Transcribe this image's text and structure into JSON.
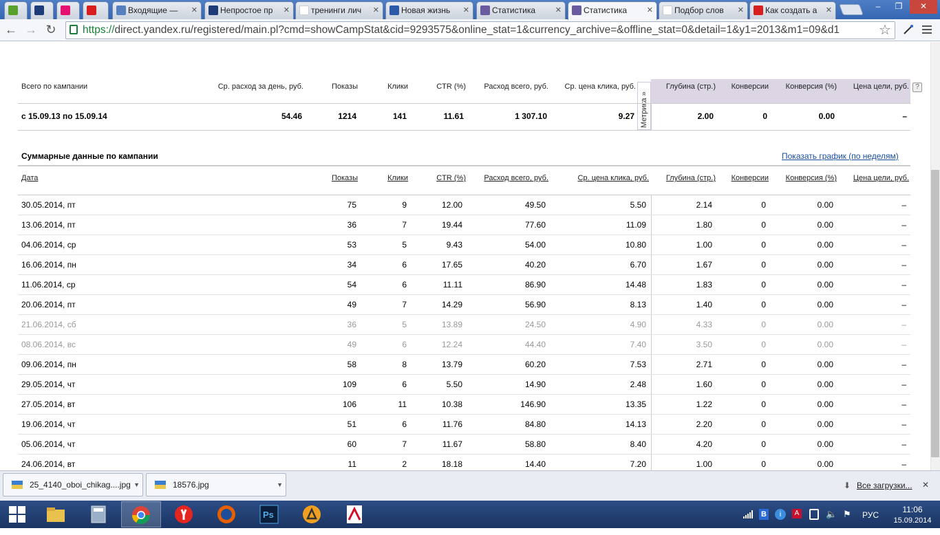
{
  "tabs": [
    {
      "label": "",
      "favicon": "green-f-icon"
    },
    {
      "label": "",
      "favicon": "bm-icon"
    },
    {
      "label": "",
      "favicon": "pink-icon"
    },
    {
      "label": "",
      "favicon": "red-2-icon"
    },
    {
      "label": "Входящие — ",
      "favicon": "mail-icon"
    },
    {
      "label": "Непростое пр",
      "favicon": "bm-icon"
    },
    {
      "label": "тренинги лич",
      "favicon": "yandex-icon"
    },
    {
      "label": "Новая жизнь",
      "favicon": "doc-icon"
    },
    {
      "label": "Статистика",
      "favicon": "direct-icon"
    },
    {
      "label": "Статистика",
      "favicon": "direct-icon",
      "active": true
    },
    {
      "label": "Подбор слов",
      "favicon": "chart-icon"
    },
    {
      "label": "Как создать а",
      "favicon": "youtube-icon"
    }
  ],
  "window": {
    "minimize": "–",
    "restore": "❐",
    "close": "✕"
  },
  "toolbar": {
    "back": "←",
    "forward": "→",
    "reload": "↻",
    "url_scheme": "https://",
    "url_rest": "direct.yandex.ru/registered/main.pl?cmd=showCampStat&cid=9293575&online_stat=1&currency_archive=&offline_stat=0&detail=1&y1=2013&m1=09&d1",
    "star": "☆"
  },
  "summary": {
    "headers": [
      "Всего по кампании",
      "Ср. расход за день, руб.",
      "Показы",
      "Клики",
      "CTR (%)",
      "Расход всего, руб.",
      "Ср. цена клика, руб.",
      "Глубина (стр.)",
      "Конверсии",
      "Конверсия (%)",
      "Цена цели, руб."
    ],
    "values": [
      "с 15.09.13 по 15.09.14",
      "54.46",
      "1214",
      "141",
      "11.61",
      "1 307.10",
      "9.27",
      "2.00",
      "0",
      "0.00",
      "–"
    ],
    "help": "?",
    "metrika": "Метрика »"
  },
  "section": {
    "title": "Суммарные данные по кампании",
    "graph_link": "Показать график (по неделям)"
  },
  "detail_headers": [
    "Дата",
    "Показы",
    "Клики",
    "CTR (%)",
    "Расход всего, руб.",
    "Ср. цена клика, руб.",
    "Глубина (стр.)",
    "Конверсии",
    "Конверсия (%)",
    "Цена цели, руб."
  ],
  "rows": [
    {
      "cells": [
        "30.05.2014, пт",
        "75",
        "9",
        "12.00",
        "49.50",
        "5.50",
        "2.14",
        "0",
        "0.00",
        "–"
      ]
    },
    {
      "cells": [
        "13.06.2014, пт",
        "36",
        "7",
        "19.44",
        "77.60",
        "11.09",
        "1.80",
        "0",
        "0.00",
        "–"
      ]
    },
    {
      "cells": [
        "04.06.2014, ср",
        "53",
        "5",
        "9.43",
        "54.00",
        "10.80",
        "1.00",
        "0",
        "0.00",
        "–"
      ]
    },
    {
      "cells": [
        "16.06.2014, пн",
        "34",
        "6",
        "17.65",
        "40.20",
        "6.70",
        "1.67",
        "0",
        "0.00",
        "–"
      ]
    },
    {
      "cells": [
        "11.06.2014, ср",
        "54",
        "6",
        "11.11",
        "86.90",
        "14.48",
        "1.83",
        "0",
        "0.00",
        "–"
      ]
    },
    {
      "cells": [
        "20.06.2014, пт",
        "49",
        "7",
        "14.29",
        "56.90",
        "8.13",
        "1.40",
        "0",
        "0.00",
        "–"
      ]
    },
    {
      "cells": [
        "21.06.2014, сб",
        "36",
        "5",
        "13.89",
        "24.50",
        "4.90",
        "4.33",
        "0",
        "0.00",
        "–"
      ],
      "weekend": true
    },
    {
      "cells": [
        "08.06.2014, вс",
        "49",
        "6",
        "12.24",
        "44.40",
        "7.40",
        "3.50",
        "0",
        "0.00",
        "–"
      ],
      "weekend": true
    },
    {
      "cells": [
        "09.06.2014, пн",
        "58",
        "8",
        "13.79",
        "60.20",
        "7.53",
        "2.71",
        "0",
        "0.00",
        "–"
      ]
    },
    {
      "cells": [
        "29.05.2014, чт",
        "109",
        "6",
        "5.50",
        "14.90",
        "2.48",
        "1.60",
        "0",
        "0.00",
        "–"
      ]
    },
    {
      "cells": [
        "27.05.2014, вт",
        "106",
        "11",
        "10.38",
        "146.90",
        "13.35",
        "1.22",
        "0",
        "0.00",
        "–"
      ]
    },
    {
      "cells": [
        "19.06.2014, чт",
        "51",
        "6",
        "11.76",
        "84.80",
        "14.13",
        "2.20",
        "0",
        "0.00",
        "–"
      ]
    },
    {
      "cells": [
        "05.06.2014, чт",
        "60",
        "7",
        "11.67",
        "58.80",
        "8.40",
        "4.20",
        "0",
        "0.00",
        "–"
      ]
    },
    {
      "cells": [
        "24.06.2014, вт",
        "11",
        "2",
        "18.18",
        "14.40",
        "7.20",
        "1.00",
        "0",
        "0.00",
        "–"
      ]
    }
  ],
  "downloads": {
    "items": [
      "25_4140_oboi_chikag....jpg",
      "18576.jpg"
    ],
    "all_link": "Все загрузки...",
    "close": "✕"
  },
  "taskbar": {
    "apps": [
      "windows-start-icon",
      "explorer-icon",
      "calculator-icon",
      "chrome-icon",
      "yandex-browser-icon",
      "firefox-icon",
      "photoshop-icon",
      "aimp-icon",
      "acrobat-icon"
    ],
    "lang": "РУС",
    "time": "11:06",
    "date": "15.09.2014"
  }
}
